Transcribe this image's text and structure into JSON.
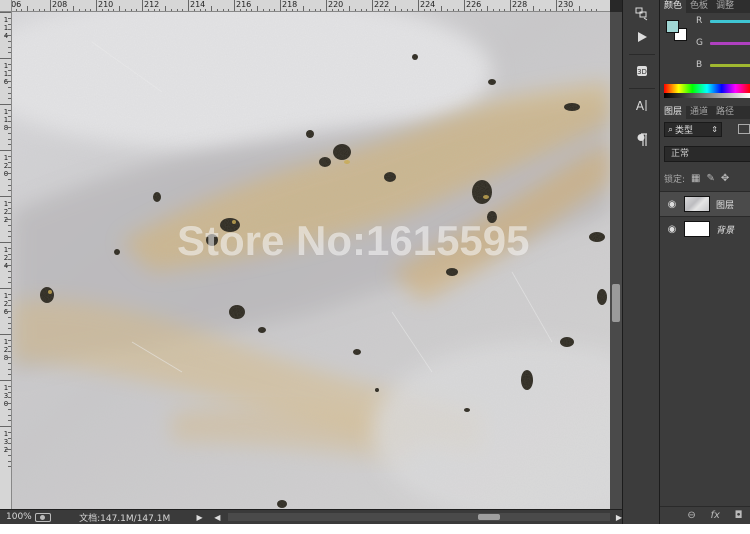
{
  "ruler": {
    "h_labels": [
      "206",
      "208",
      "210",
      "212",
      "214",
      "216",
      "218",
      "220",
      "222",
      "224",
      "226",
      "228",
      "230"
    ],
    "v_labels": [
      "1\n1\n4",
      "1\n1\n6",
      "1\n1\n8",
      "1\n2\n0",
      "1\n2\n2",
      "1\n2\n4",
      "1\n2\n6",
      "1\n2\n8",
      "1\n3\n0",
      "1\n3\n2"
    ]
  },
  "canvas": {
    "watermark": "Store No:1615595"
  },
  "statusbar": {
    "zoom": "100%",
    "doc_info": "文档:147.1M/147.1M",
    "arrow": "▶",
    "scroll_left": "◀",
    "scroll_right": "▶"
  },
  "tools": {
    "icons": [
      "history-icon",
      "play-icon",
      "3d-icon",
      "character-icon",
      "paragraph-icon"
    ]
  },
  "color_panel": {
    "tabs": [
      "颜色",
      "色板",
      "调整"
    ],
    "channels": [
      {
        "label": "R",
        "color": "#3fc6d4"
      },
      {
        "label": "G",
        "color": "#b040c0"
      },
      {
        "label": "B",
        "color": "#a0b830"
      }
    ],
    "foreground_color": "#9fd6d4",
    "background_color": "#ffffff"
  },
  "layers_panel": {
    "tabs": [
      "图层",
      "通道",
      "路径"
    ],
    "filter_label": "类型",
    "blend_mode": "正常",
    "lock_label": "锁定:",
    "layers": [
      {
        "name": "图层",
        "thumb": "marble"
      },
      {
        "name": "背景",
        "thumb": "white"
      }
    ],
    "footer_icons": [
      "link-icon",
      "fx-icon",
      "mask-icon"
    ],
    "footer_labels": [
      "⊖",
      "fx",
      "◘"
    ]
  }
}
